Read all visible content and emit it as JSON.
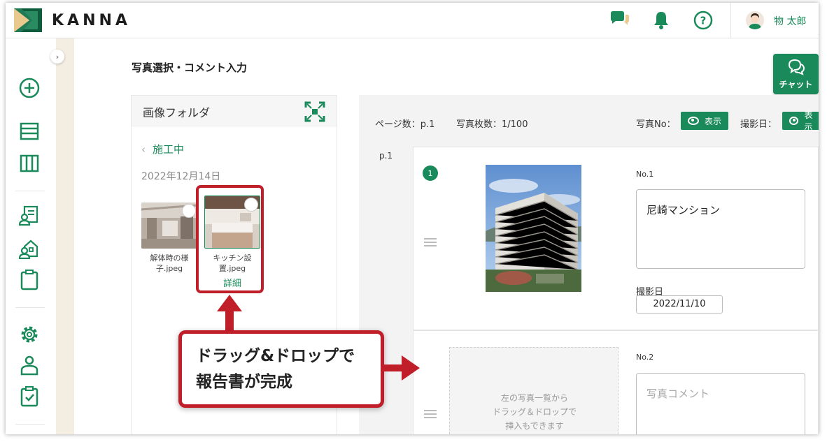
{
  "header": {
    "logo_text": "KANNA",
    "user_name": "物 太郎"
  },
  "sidebar": {
    "icons": [
      "plus-circle-icon",
      "list-icon",
      "board-icon",
      "person-card-icon",
      "house-person-icon",
      "clipboard-icon",
      "gear-icon",
      "person-icon",
      "clipboard-check-icon"
    ]
  },
  "page": {
    "title": "写真選択・コメント入力",
    "chat_label": "チャット"
  },
  "folder": {
    "title": "画像フォルダ",
    "back_label": "施工中",
    "date": "2022年12月14日",
    "thumbnails": [
      {
        "caption": "解体時の様子.jpeg"
      },
      {
        "caption": "キッチン設置.jpeg",
        "detail": "詳細"
      }
    ]
  },
  "report": {
    "page_count": "ページ数：p.1",
    "photo_count": "写真枚数：1/100",
    "photo_no_label": "写真No：",
    "show_label": "表示",
    "date_label": "撮影日：",
    "page_label": "p.1",
    "cards": [
      {
        "badge": "1",
        "no": "No.1",
        "comment": "尼崎マンション",
        "date_label": "撮影日",
        "date": "2022/11/10"
      },
      {
        "no": "No.2",
        "placeholder": "写真コメント",
        "drop_line1": "左の写真一覧から",
        "drop_line2": "ドラッグ＆ドロップで",
        "drop_line3": "挿入もできます"
      }
    ]
  },
  "callout": {
    "line1": "ドラッグ&ドロップで",
    "line2": "報告書が完成"
  },
  "colors": {
    "brand_green": "#1a8a5a",
    "highlight_red": "#c01f2a"
  }
}
